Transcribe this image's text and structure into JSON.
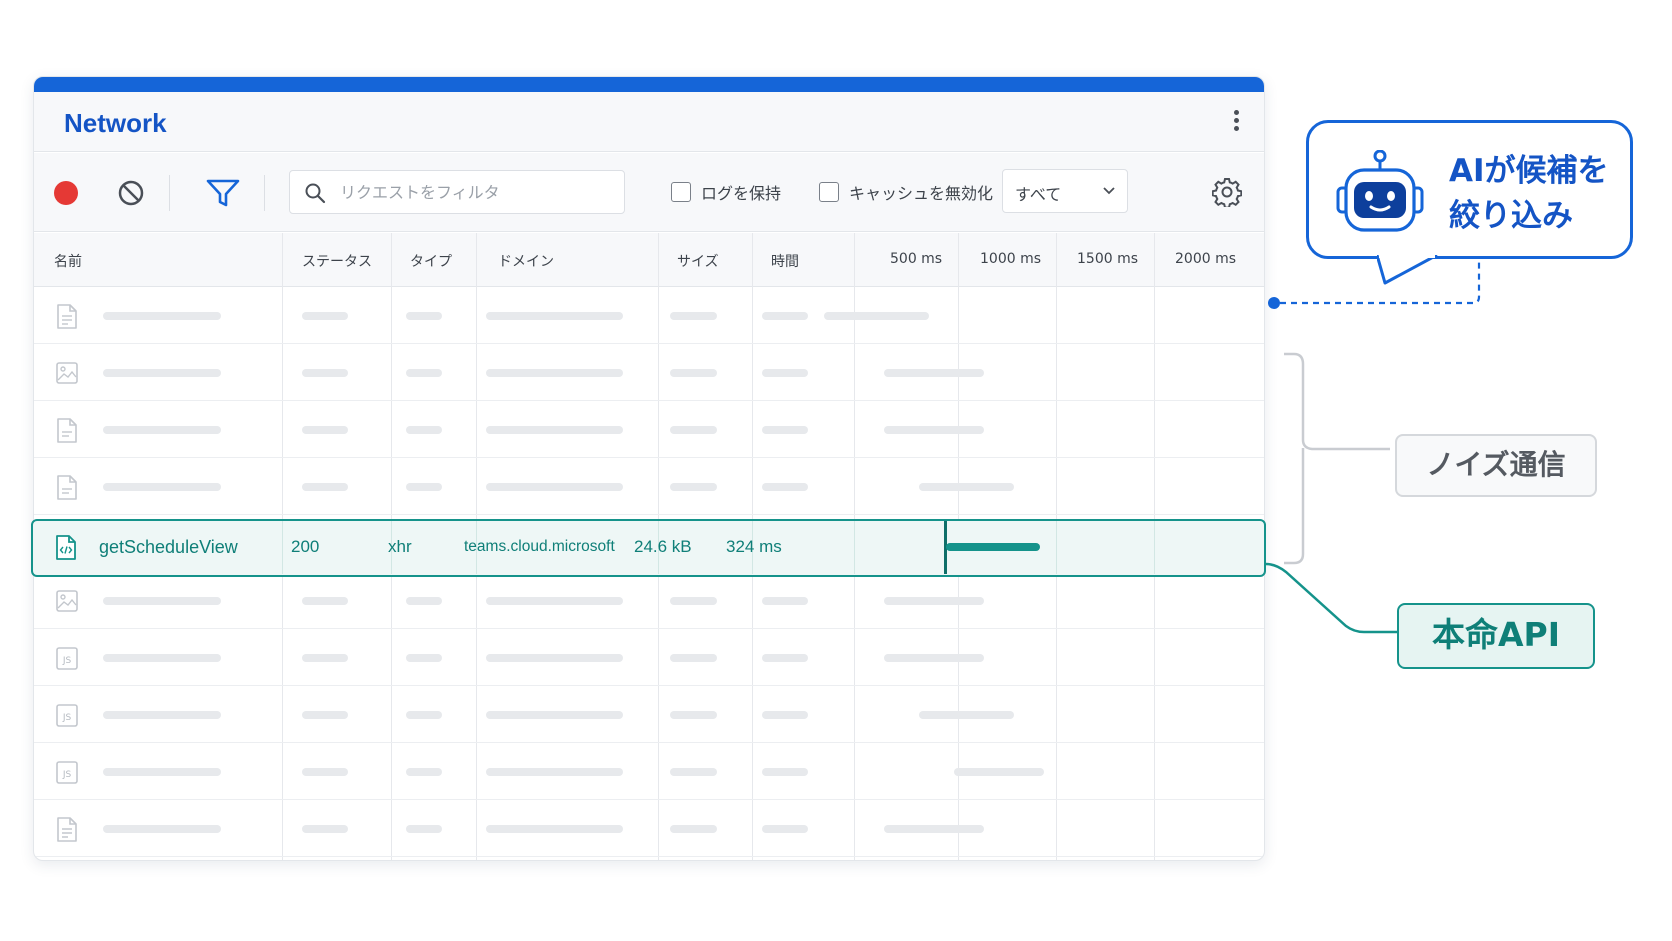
{
  "window": {
    "title": "Network",
    "accent_color": "#1565d8"
  },
  "toolbar": {
    "record_icon": "record-icon",
    "clear_icon": "clear-icon",
    "filter_icon": "filter-icon",
    "search_placeholder": "リクエストをフィルタ",
    "preserve_log_label": "ログを保持",
    "disable_cache_label": "キャッシュを無効化",
    "type_select_value": "すべて",
    "settings_icon": "gear-icon"
  },
  "table": {
    "headers": {
      "name": "名前",
      "status": "ステータス",
      "type": "タイプ",
      "domain": "ドメイン",
      "size": "サイズ",
      "time": "時間",
      "t500": "500 ms",
      "t1000": "1000 ms",
      "t1500": "1500 ms",
      "t2000": "2000 ms"
    },
    "row_icons": [
      "document-icon",
      "image-icon",
      "text-icon",
      "text-icon",
      "code-file-icon",
      "image-icon",
      "js-file-icon",
      "js-file-icon",
      "js-file-icon",
      "document-icon"
    ],
    "highlighted_row": {
      "name": "getScheduleView",
      "status": "200",
      "type": "xhr",
      "domain": "teams.cloud.microsoft",
      "size": "24.6 kB",
      "time": "324 ms",
      "highlight_color": "#15938b"
    }
  },
  "annotations": {
    "ai_bubble_line1": "AIが候補を",
    "ai_bubble_line2": "絞り込み",
    "robot_icon": "robot-icon",
    "noise_label": "ノイズ通信",
    "target_label": "本命API"
  }
}
